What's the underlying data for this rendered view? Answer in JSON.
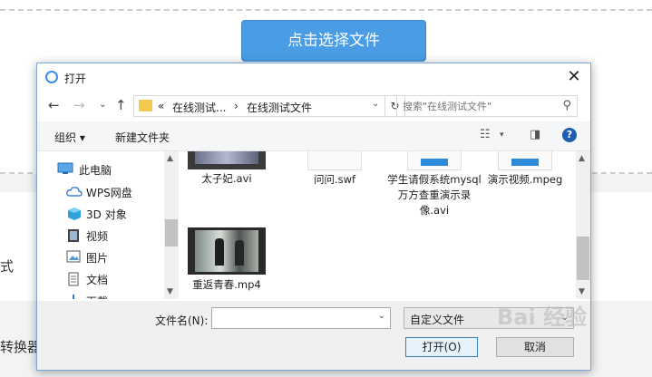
{
  "background": {
    "choose_button_label": "点击选择文件",
    "left_text_1": "式",
    "left_text_2": "转换器"
  },
  "dialog": {
    "title": "打开",
    "close_glyph": "✕",
    "address": {
      "prefix": "«",
      "segment1": "在线测试...",
      "separator": "›",
      "segment2": "在线测试文件"
    },
    "search_placeholder": "搜索\"在线测试文件\"",
    "toolbar": {
      "organize": "组织 ▾",
      "new_folder": "新建文件夹"
    },
    "nav_items": [
      {
        "label": "此电脑",
        "icon": "computer-icon"
      },
      {
        "label": "WPS网盘",
        "icon": "cloud-icon"
      },
      {
        "label": "3D 对象",
        "icon": "cube-icon"
      },
      {
        "label": "视频",
        "icon": "video-icon"
      },
      {
        "label": "图片",
        "icon": "picture-icon"
      },
      {
        "label": "文档",
        "icon": "document-icon"
      },
      {
        "label": "下载",
        "icon": "download-icon"
      }
    ],
    "files": [
      {
        "name": "太子妃.avi",
        "kind": "video"
      },
      {
        "name": "问问.swf",
        "kind": "blank"
      },
      {
        "name": "学生请假系统mysql万方查重演示录像.avi",
        "kind": "generic"
      },
      {
        "name": "演示视频.mpeg",
        "kind": "generic"
      },
      {
        "name": "重返青春.mp4",
        "kind": "video"
      }
    ],
    "file_name_label": "文件名(N):",
    "file_name_value": "",
    "file_type": "自定义文件",
    "open_button": "打开(O)",
    "cancel_button": "取消"
  },
  "watermark": "Bai 经验"
}
